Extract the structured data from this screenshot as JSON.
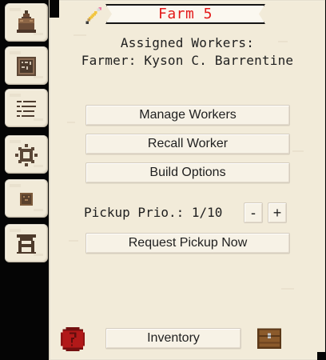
{
  "sidebar": {
    "tabs": [
      {
        "name": "cake-icon"
      },
      {
        "name": "calendar-icon"
      },
      {
        "name": "list-icon"
      },
      {
        "name": "gear-icon"
      },
      {
        "name": "crate-icon"
      },
      {
        "name": "shrine-icon"
      }
    ]
  },
  "panel": {
    "title": "Farm 5",
    "assigned_heading": "Assigned Workers:",
    "farmer_line": "Farmer: Kyson C. Barrentine",
    "buttons": {
      "manage_workers": "Manage Workers",
      "recall_worker": "Recall Worker",
      "build_options": "Build Options",
      "request_pickup_now": "Request Pickup Now",
      "inventory": "Inventory"
    },
    "pickup_priority": {
      "label": "Pickup Prio.: 1/10",
      "minus": "-",
      "plus": "+"
    }
  },
  "colors": {
    "title_red": "#e31a1a",
    "panel_bg": "#f2ebd9",
    "button_bg": "#f7f2e6",
    "help_red": "#b21919",
    "chest_brown": "#8b5a2b"
  }
}
